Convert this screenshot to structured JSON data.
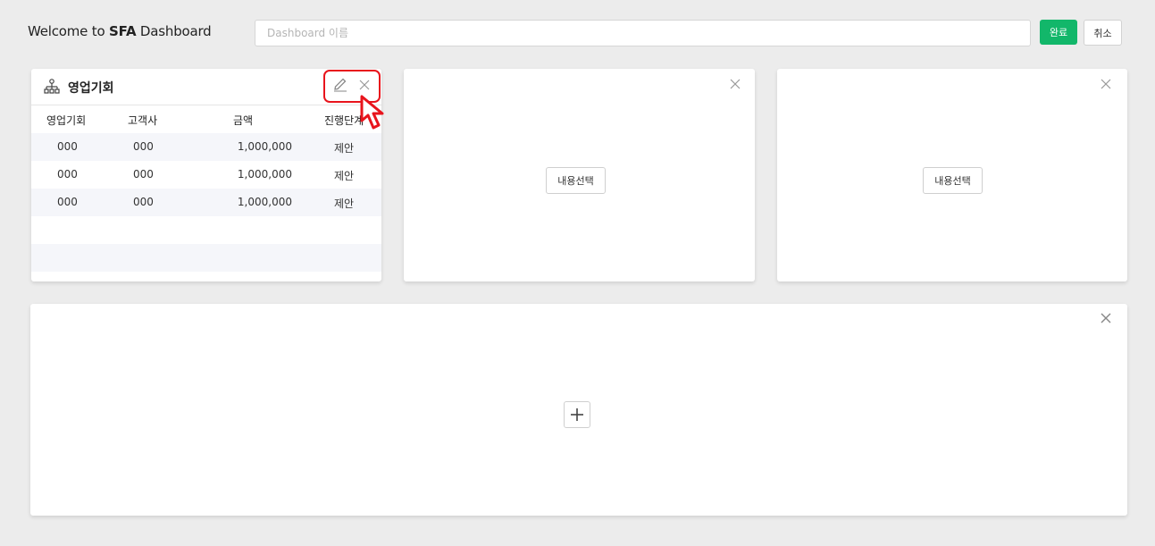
{
  "header": {
    "title_prefix": "Welcome to ",
    "title_brand": "SFA",
    "title_suffix": " Dashboard",
    "name_input_placeholder": "Dashboard 이름",
    "name_input_value": "",
    "done_label": "완료",
    "cancel_label": "취소"
  },
  "widget1": {
    "title": "영업기회",
    "icon": "hierarchy-icon",
    "columns": [
      "영업기회",
      "고객사",
      "금액",
      "진행단계"
    ],
    "rows": [
      [
        "000",
        "000",
        "1,000,000",
        "제안"
      ],
      [
        "000",
        "000",
        "1,000,000",
        "제안"
      ],
      [
        "000",
        "000",
        "1,000,000",
        "제안"
      ]
    ]
  },
  "widget2": {
    "select_label": "내용선택"
  },
  "widget3": {
    "select_label": "내용선택"
  },
  "colors": {
    "accent": "#12b76a",
    "highlight": "#e8141c",
    "background": "#ececec",
    "alt_row": "#f5f6fa"
  }
}
